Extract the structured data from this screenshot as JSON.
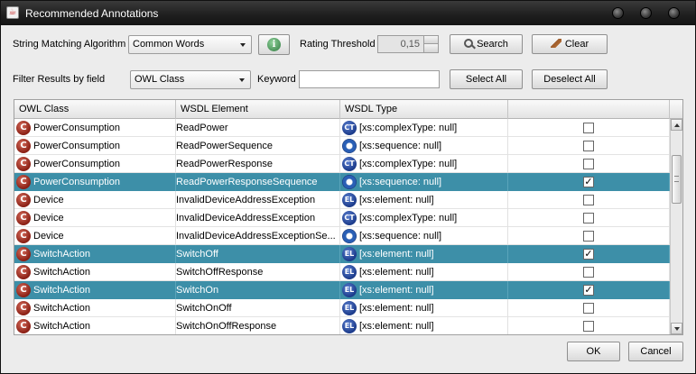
{
  "window": {
    "title": "Recommended Annotations",
    "app_icon": "java-icon"
  },
  "toolbar": {
    "algorithm_label": "String Matching Algorithm",
    "algorithm_value": "Common Words",
    "threshold_label": "Rating Threshold",
    "threshold_value": "0,15",
    "search_label": "Search",
    "clear_label": "Clear",
    "filter_label": "Filter Results by field",
    "filter_value": "OWL Class",
    "keyword_label": "Keyword",
    "keyword_value": "",
    "select_all_label": "Select All",
    "deselect_all_label": "Deselect All"
  },
  "table": {
    "columns": [
      "OWL Class",
      "WSDL Element",
      "WSDL Type",
      ""
    ],
    "rows": [
      {
        "owl_class": "PowerConsumption",
        "wsdl_element": "ReadPower",
        "type_icon": "CT",
        "wsdl_type": "[xs:complexType: null]",
        "checked": false,
        "selected": false
      },
      {
        "owl_class": "PowerConsumption",
        "wsdl_element": "ReadPowerSequence",
        "type_icon": "SEQ",
        "wsdl_type": "[xs:sequence: null]",
        "checked": false,
        "selected": false
      },
      {
        "owl_class": "PowerConsumption",
        "wsdl_element": "ReadPowerResponse",
        "type_icon": "CT",
        "wsdl_type": "[xs:complexType: null]",
        "checked": false,
        "selected": false
      },
      {
        "owl_class": "PowerConsumption",
        "wsdl_element": "ReadPowerResponseSequence",
        "type_icon": "SEQ",
        "wsdl_type": "[xs:sequence: null]",
        "checked": true,
        "selected": true
      },
      {
        "owl_class": "Device",
        "wsdl_element": "InvalidDeviceAddressException",
        "type_icon": "EL",
        "wsdl_type": "[xs:element: null]",
        "checked": false,
        "selected": false
      },
      {
        "owl_class": "Device",
        "wsdl_element": "InvalidDeviceAddressException",
        "type_icon": "CT",
        "wsdl_type": "[xs:complexType: null]",
        "checked": false,
        "selected": false
      },
      {
        "owl_class": "Device",
        "wsdl_element": "InvalidDeviceAddressExceptionSe...",
        "type_icon": "SEQ",
        "wsdl_type": "[xs:sequence: null]",
        "checked": false,
        "selected": false
      },
      {
        "owl_class": "SwitchAction",
        "wsdl_element": "SwitchOff",
        "type_icon": "EL",
        "wsdl_type": "[xs:element: null]",
        "checked": true,
        "selected": true
      },
      {
        "owl_class": "SwitchAction",
        "wsdl_element": "SwitchOffResponse",
        "type_icon": "EL",
        "wsdl_type": "[xs:element: null]",
        "checked": false,
        "selected": false
      },
      {
        "owl_class": "SwitchAction",
        "wsdl_element": "SwitchOn",
        "type_icon": "EL",
        "wsdl_type": "[xs:element: null]",
        "checked": true,
        "selected": true
      },
      {
        "owl_class": "SwitchAction",
        "wsdl_element": "SwitchOnOff",
        "type_icon": "EL",
        "wsdl_type": "[xs:element: null]",
        "checked": false,
        "selected": false
      },
      {
        "owl_class": "SwitchAction",
        "wsdl_element": "SwitchOnOffResponse",
        "type_icon": "EL",
        "wsdl_type": "[xs:element: null]",
        "checked": false,
        "selected": false
      }
    ]
  },
  "footer": {
    "ok_label": "OK",
    "cancel_label": "Cancel"
  },
  "colors": {
    "selection": "#3d8fa8",
    "class_badge": "#8a1f14",
    "type_badge": "#1b3a8a"
  }
}
